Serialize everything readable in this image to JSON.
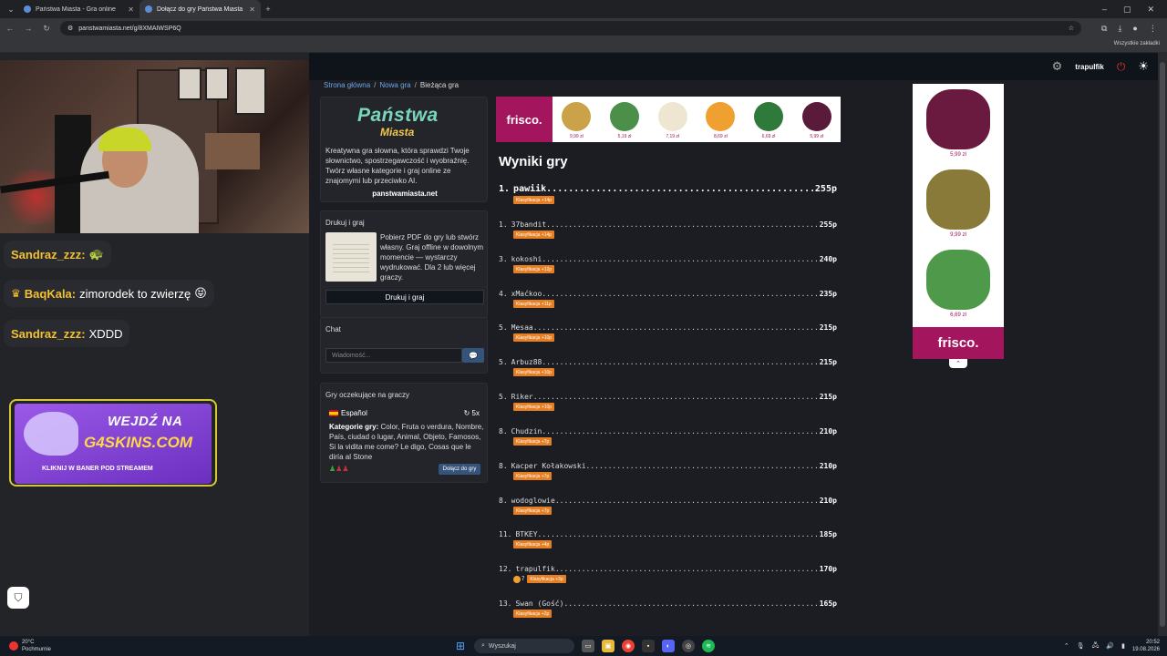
{
  "browser": {
    "tabs": [
      {
        "title": "Państwa Miasta - Gra online",
        "active": false
      },
      {
        "title": "Dołącz do gry Państwa Miasta",
        "active": true
      }
    ],
    "url": "panstwamiasta.net/g/8XMAIWSP6Q",
    "bookmarks_all": "Wszystkie zakładki"
  },
  "stream": {
    "chat": [
      {
        "user": "Sandraz_zzz:",
        "text": "",
        "emoji": "🐢",
        "crown": false
      },
      {
        "user": "BaqKala:",
        "text": "zimorodek to zwierzę",
        "emoji": "😝",
        "crown": true
      },
      {
        "user": "Sandraz_zzz:",
        "text": "XDDD",
        "emoji": "",
        "crown": false
      }
    ],
    "ad": {
      "line1": "WEJDŹ NA",
      "line2": "G4SKINS.COM",
      "cta": "KLIKNIJ W BANER POD STREAMEM"
    }
  },
  "app": {
    "header": {
      "username": "trapulfik"
    },
    "breadcrumb": {
      "home": "Strona główna",
      "new_game": "Nowa gra",
      "current": "Bieżąca gra"
    },
    "logo": {
      "line1": "Państwa",
      "line2": "Miasta"
    },
    "intro": "Kreatywna gra słowna, która sprawdzi Twoje słownictwo, spostrzegawczość i wyobraźnię. Twórz własne kategorie i graj online ze znajomymi lub przeciwko AI.",
    "site": "panstwamiasta.net",
    "print": {
      "title": "Drukuj i graj",
      "desc": "Pobierz PDF do gry lub stwórz własny. Graj offline w dowolnym momencie — wystarczy wydrukować. Dla 2 lub więcej graczy.",
      "button": "Drukuj i graj"
    },
    "chat": {
      "title": "Chat",
      "placeholder": "Wiadomość..."
    },
    "waiting": {
      "title": "Gry oczekujące na graczy",
      "language": "Español",
      "rounds": "5x",
      "categories_label": "Kategorie gry:",
      "categories": "Color, Fruta o verdura, Nombre, País, ciudad o lugar, Animal, Objeto, Famosos, Si la vidita me come? Le digo, Cosas que le diría al Stone",
      "join": "Dołącz do gry"
    },
    "results_title": "Wyniki gry",
    "results": [
      {
        "rank": "1.",
        "name": "pawiik",
        "points": "255p",
        "badge": "Klasyfikacja +14p",
        "emoji_count": ""
      },
      {
        "rank": "1.",
        "name": "37bandit",
        "points": "255p",
        "badge": "Klasyfikacja +14p",
        "emoji_count": ""
      },
      {
        "rank": "3.",
        "name": "kokoshi",
        "points": "240p",
        "badge": "Klasyfikacja +12p",
        "emoji_count": ""
      },
      {
        "rank": "4.",
        "name": "xMaćkoo",
        "points": "235p",
        "badge": "Klasyfikacja +11p",
        "emoji_count": ""
      },
      {
        "rank": "5.",
        "name": "Mesaa",
        "points": "215p",
        "badge": "Klasyfikacja +10p",
        "emoji_count": ""
      },
      {
        "rank": "5.",
        "name": "Arbuz88",
        "points": "215p",
        "badge": "Klasyfikacja +10p",
        "emoji_count": ""
      },
      {
        "rank": "5.",
        "name": "Riker",
        "points": "215p",
        "badge": "Klasyfikacja +10p",
        "emoji_count": ""
      },
      {
        "rank": "8.",
        "name": "Chudzin",
        "points": "210p",
        "badge": "Klasyfikacja +7p",
        "emoji_count": ""
      },
      {
        "rank": "8.",
        "name": "Kacper Kołakowski",
        "points": "210p",
        "badge": "Klasyfikacja +7p",
        "emoji_count": ""
      },
      {
        "rank": "8.",
        "name": "wodoglowie",
        "points": "210p",
        "badge": "Klasyfikacja +7p",
        "emoji_count": ""
      },
      {
        "rank": "11.",
        "name": "BTKEY",
        "points": "185p",
        "badge": "Klasyfikacja +4p",
        "emoji_count": ""
      },
      {
        "rank": "12.",
        "name": "trapulfik",
        "points": "170p",
        "badge": "Klasyfikacja +3p",
        "emoji_count": "7"
      },
      {
        "rank": "13.",
        "name": "Swan (Gość)",
        "points": "165p",
        "badge": "Klasyfikacja +2p",
        "emoji_count": ""
      }
    ],
    "banner": {
      "brand": "frisco.",
      "prices": [
        "9,99 zł",
        "5,19 zł",
        "7,19 zł",
        "8,69 zł",
        "6,69 zł",
        "5,99 zł"
      ],
      "colors": [
        "#c9a24a",
        "#4b8f4a",
        "#efe6d2",
        "#f0a030",
        "#2f7a3a",
        "#5a1a3a"
      ]
    },
    "side_ad": {
      "brand": "frisco.",
      "prices": [
        "5,99 zł",
        "9,99 zł",
        "6,69 zł"
      ],
      "colors": [
        "#6a1a3e",
        "#8a7a3a",
        "#4f9a4a"
      ]
    }
  },
  "taskbar": {
    "weather_temp": "20°C",
    "weather_desc": "Pochmurnie",
    "search": "Wyszukaj",
    "time": "20:52",
    "date": "19.08.2026"
  }
}
